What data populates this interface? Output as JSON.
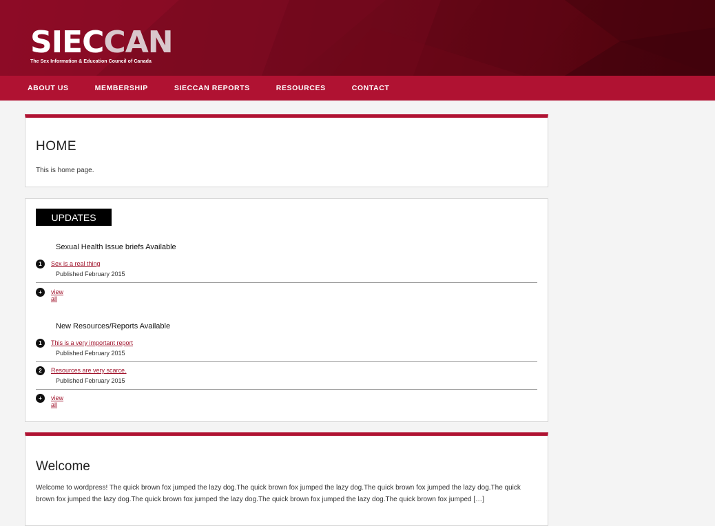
{
  "logo": {
    "word_main": "SIEC",
    "word_dim": "CAN",
    "tagline": "The Sex Information & Education Council of Canada"
  },
  "nav": [
    "ABOUT US",
    "MEMBERSHIP",
    "SIECCAN REPORTS",
    "RESOURCES",
    "CONTACT"
  ],
  "home": {
    "title": "HOME",
    "text": "This is home page."
  },
  "updates": {
    "tab_label": "UPDATES",
    "groups": [
      {
        "title": "Sexual Health Issue briefs Available",
        "items": [
          {
            "num": "1",
            "title": "Sex is a real thing",
            "published": "Published February 2015"
          }
        ],
        "view_all": "view all"
      },
      {
        "title": "New Resources/Reports Available",
        "items": [
          {
            "num": "1",
            "title": "This is a very important report",
            "published": "Published February 2015"
          },
          {
            "num": "2",
            "title": "Resources are very scarce.",
            "published": "Published February 2015"
          }
        ],
        "view_all": "view all"
      }
    ],
    "plus_symbol": "+"
  },
  "welcome": {
    "title": "Welcome",
    "text": "Welcome to wordpress! The quick brown fox jumped the lazy dog.The quick brown fox jumped the lazy dog.The quick brown fox jumped the lazy dog.The quick brown fox jumped the lazy dog.The quick brown fox jumped the lazy dog.The quick brown fox jumped the lazy dog.The quick brown fox jumped […]"
  },
  "colors": {
    "brand_red": "#b01232",
    "header_dark": "#6a0718",
    "link_red": "#a0142c"
  }
}
